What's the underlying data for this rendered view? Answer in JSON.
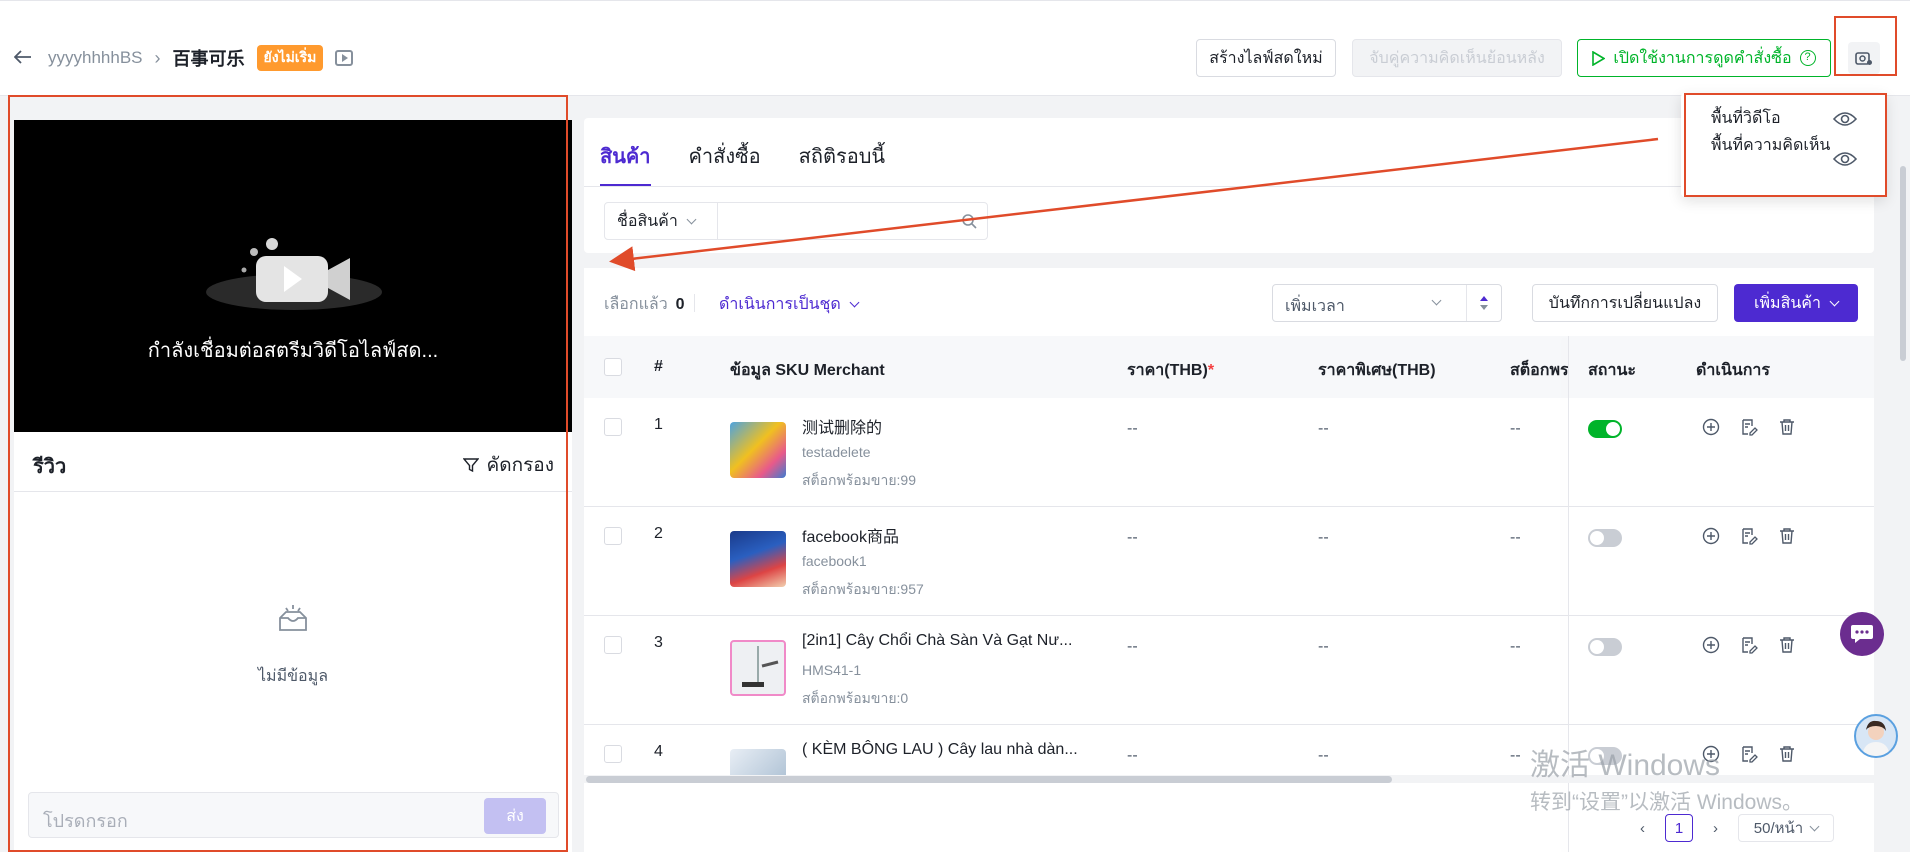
{
  "header": {
    "breadcrumb_link": "yyyyhhhhBS",
    "title": "百事可乐",
    "status_badge": "ยังไม่เริ่ม",
    "create_live_button": "สร้างไลฟ์สดใหม่",
    "match_comments_button": "จับคู่ความคิดเห็นย้อนหลัง",
    "enable_orders_button": "เปิดใช้งานการดูดคำสั่งซื้อ"
  },
  "layout_menu": {
    "items": [
      "พื้นที่วิดีโอ",
      "พื้นที่ความคิดเห็น"
    ]
  },
  "video": {
    "connecting_text": "กำลังเชื่อมต่อสตรีมวิดีโอไลฟ์สด..."
  },
  "reviews": {
    "title": "รีวิว",
    "filter_label": "คัดกรอง",
    "empty_text": "ไม่มีข้อมูล",
    "input_placeholder": "โปรดกรอก",
    "send_label": "ส่ง"
  },
  "tabs": [
    "สินค้า",
    "คำสั่งซื้อ",
    "สถิติรอบนี้"
  ],
  "search": {
    "field_select": "ชื่อสินค้า"
  },
  "toolbar": {
    "selected_label": "เลือกแล้ว",
    "selected_count": "0",
    "batch_label": "ดำเนินการเป็นชุด",
    "time_select": "เพิ่มเวลา",
    "save_label": "บันทึกการเปลี่ยนแปลง",
    "add_label": "เพิ่มสินค้า"
  },
  "table": {
    "columns": {
      "index": "#",
      "sku": "ข้อมูล SKU Merchant",
      "price": "ราคา(THB)",
      "price_required": "*",
      "special_price": "ราคาพิเศษ(THB)",
      "stock": "สต็อกพร",
      "status": "สถานะ",
      "actions": "ดำเนินการ"
    },
    "rows": [
      {
        "num": "1",
        "name": "测试删除的",
        "sku": "testadelete",
        "stock": "สต็อกพร้อมขาย:99",
        "price": "--",
        "special": "--",
        "stock_col": "--",
        "enabled": true
      },
      {
        "num": "2",
        "name": "facebook商品",
        "sku": "facebook1",
        "stock": "สต็อกพร้อมขาย:957",
        "price": "--",
        "special": "--",
        "stock_col": "--",
        "enabled": false
      },
      {
        "num": "3",
        "name": "[2in1] Cây Chổi Chà Sàn Và Gạt Nư...",
        "sku": "HMS41-1",
        "stock": "สต็อกพร้อมขาย:0",
        "price": "--",
        "special": "--",
        "stock_col": "--",
        "enabled": false
      },
      {
        "num": "4",
        "name": "( KÈM BÔNG LAU ) Cây lau nhà dàn...",
        "sku": "",
        "stock": "",
        "price": "--",
        "special": "--",
        "stock_col": "--",
        "enabled": false
      }
    ]
  },
  "pagination": {
    "current_page": "1",
    "per_page": "50/หน้า"
  },
  "watermark": {
    "line1": "激活 Windows",
    "line2": "转到“设置”以激活 Windows。"
  },
  "colors": {
    "accent": "#4d2ad1",
    "success": "#00b42a",
    "badge": "#ff9a2e",
    "annotation": "#e04b2a"
  }
}
